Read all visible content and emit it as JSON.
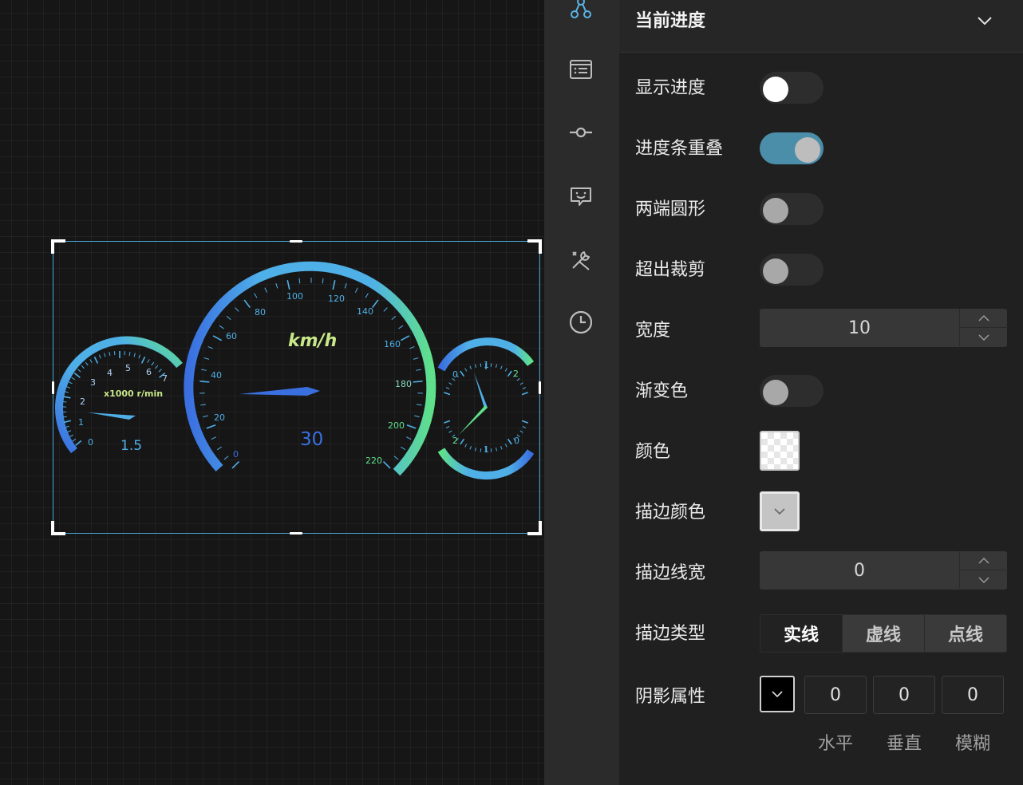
{
  "gauges": {
    "rpm_unit": "x1000 r/min",
    "rpm_value": "1.5",
    "rpm_ticks": [
      "0",
      "1",
      "2",
      "3",
      "4",
      "5",
      "6",
      "7"
    ],
    "speed_unit": "km/h",
    "speed_value": "30",
    "speed_ticks": [
      "0",
      "20",
      "40",
      "60",
      "80",
      "100",
      "120",
      "140",
      "160",
      "180",
      "200",
      "220"
    ],
    "clock_top_ticks": [
      "0",
      "1",
      "2"
    ],
    "clock_bottom_ticks": [
      "2",
      "1",
      "0"
    ]
  },
  "iconbar": {
    "items": [
      "nodes-icon",
      "list-icon",
      "commit-icon",
      "chat-bot-icon",
      "tools-icon",
      "clock-icon"
    ]
  },
  "panel": {
    "title": "当前进度",
    "show_progress_label": "显示进度",
    "overlap_label": "进度条重叠",
    "round_ends_label": "两端圆形",
    "clip_label": "超出裁剪",
    "width_label": "宽度",
    "width_value": "10",
    "gradient_label": "渐变色",
    "color_label": "颜色",
    "stroke_color_label": "描边颜色",
    "stroke_width_label": "描边线宽",
    "stroke_width_value": "0",
    "stroke_type_label": "描边类型",
    "stroke_types": [
      "实线",
      "虚线",
      "点线"
    ],
    "shadow_label": "阴影属性",
    "shadow_values": [
      "0",
      "0",
      "0"
    ],
    "shadow_sublabels": [
      "水平",
      "垂直",
      "模糊"
    ]
  },
  "colors": {
    "accent": "#4b8eaa",
    "gauge_blue": "#3a6fe0",
    "gauge_cyan": "#4fb0e8",
    "gauge_green": "#5fe08a",
    "label_green": "#c8e88a"
  }
}
